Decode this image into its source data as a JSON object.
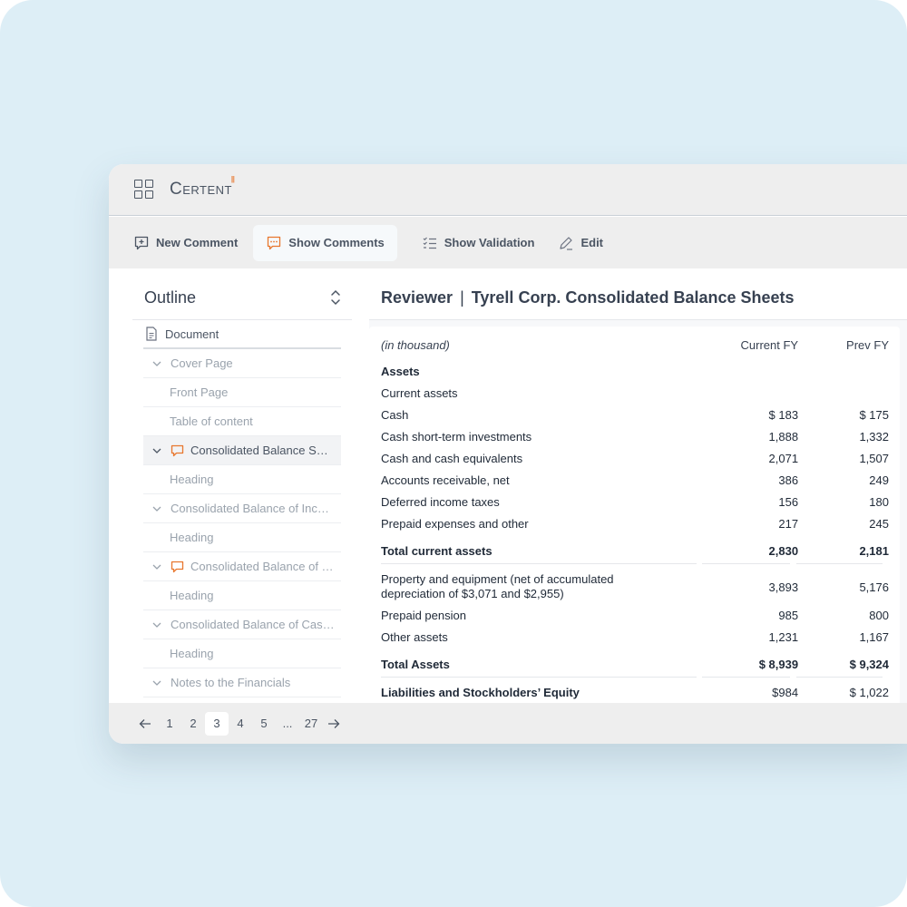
{
  "app": {
    "logo": "Certent",
    "logo_mark": "|||"
  },
  "toolbar": {
    "new_comment": "New Comment",
    "show_comments": "Show Comments",
    "show_validation": "Show Validation",
    "edit": "Edit"
  },
  "outline": {
    "title": "Outline",
    "items": [
      {
        "label": "Document"
      },
      {
        "label": "Cover Page"
      },
      {
        "label": "Front Page"
      },
      {
        "label": "Table of content"
      },
      {
        "label": "Consolidated Balance Sheets"
      },
      {
        "label": "Heading"
      },
      {
        "label": "Consolidated Balance of Income"
      },
      {
        "label": "Heading"
      },
      {
        "label": "Consolidated Balance of Equity"
      },
      {
        "label": "Heading"
      },
      {
        "label": "Consolidated Balance of Cash Flows"
      },
      {
        "label": "Heading"
      },
      {
        "label": "Notes to the Financials"
      }
    ]
  },
  "report": {
    "role": "Reviewer",
    "title": "Tyrell Corp. Consolidated Balance Sheets",
    "columns": [
      "(in thousand)",
      "Current FY",
      "Prev FY"
    ],
    "rows": [
      {
        "label": "Assets",
        "current": "",
        "prev": ""
      },
      {
        "label": "Current assets",
        "current": "",
        "prev": ""
      },
      {
        "label": "Cash",
        "current": "$ 183",
        "prev": "$ 175"
      },
      {
        "label": "Cash short-term investments",
        "current": "1,888",
        "prev": "1,332"
      },
      {
        "label": "Cash and cash equivalents",
        "current": "2,071",
        "prev": "1,507"
      },
      {
        "label": "Accounts receivable, net",
        "current": "386",
        "prev": "249"
      },
      {
        "label": "Deferred income taxes",
        "current": "156",
        "prev": "180"
      },
      {
        "label": "Prepaid expenses and other",
        "current": "217",
        "prev": "245"
      },
      {
        "label": "Total current assets",
        "current": "2,830",
        "prev": "2,181"
      },
      {
        "label": "Property and equipment (net of accumulated",
        "label2": "depreciation of $3,071 and $2,955)",
        "current": "3,893",
        "prev": "5,176"
      },
      {
        "label": "Prepaid pension",
        "current": "985",
        "prev": "800"
      },
      {
        "label": "Other assets",
        "current": "1,231",
        "prev": "1,167"
      },
      {
        "label": "Total Assets",
        "current": "$ 8,939",
        "prev": "$ 9,324"
      },
      {
        "label": "Liabilities and Stockholders’ Equity",
        "current": "$984",
        "prev": "$ 1,022"
      }
    ]
  },
  "pager": {
    "pages": [
      "1",
      "2",
      "3",
      "4",
      "5",
      "...",
      "27"
    ],
    "current": "3"
  },
  "colors": {
    "accent": "#e8772e",
    "backdrop": "#ddeef6",
    "chrome": "#eeeeee"
  }
}
